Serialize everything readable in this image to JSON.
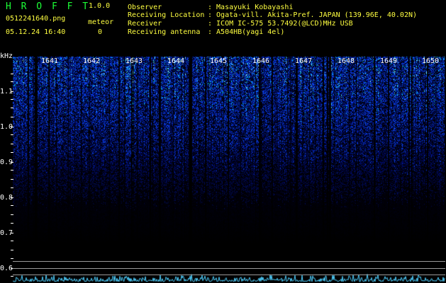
{
  "header": {
    "app_name": "H R O F F T",
    "version": "1.0.0",
    "filename": "0512241640.png",
    "datetime": "05.12.24 16:40",
    "meteor_label": "meteor",
    "meteor_count": "0",
    "info": [
      {
        "label": "Observer",
        "value": ": Masayuki Kobayashi"
      },
      {
        "label": "Receiving Location",
        "value": ": Ogata-vill. Akita-Pref. JAPAN (139.96E, 40.02N)"
      },
      {
        "label": "Receiver",
        "value": ": ICOM IC-575 53.7492(@LCD)MHz USB"
      },
      {
        "label": "Receiving antenna",
        "value": ": A504HB(yagi 4el)"
      }
    ]
  },
  "spectrogram": {
    "freq_unit": "kHz",
    "freq_labels": [
      "1.1",
      "1.0",
      "0.9",
      "0.8",
      "0.7",
      "0.6"
    ],
    "minute_labels": [
      "1641",
      "1642",
      "1643",
      "1644",
      "1645",
      "1646",
      "1647",
      "1648",
      "1649",
      "1650"
    ],
    "colors": {
      "background": "#000000",
      "signal": "#1e5cff",
      "noise_trace": "#4fd0ff",
      "text_green": "#1cff36",
      "text_yellow": "#ffff40"
    }
  }
}
